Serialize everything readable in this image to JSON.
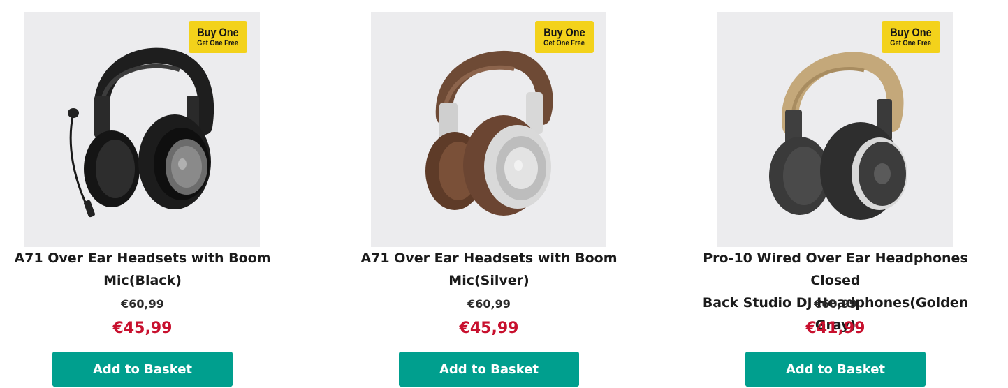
{
  "products": [
    {
      "title_line1": "A71 Over Ear Headsets with Boom",
      "title_line2": "Mic(Black)",
      "old_price": "€60,99",
      "new_price": "€45,99",
      "badge_line1": "Buy One",
      "badge_line2": "Get One Free",
      "button_label": "Add to Basket",
      "image_icon": "headset-black-boom-mic"
    },
    {
      "title_line1": "A71 Over Ear Headsets with Boom",
      "title_line2": "Mic(Silver)",
      "old_price": "€60,99",
      "new_price": "€45,99",
      "badge_line1": "Buy One",
      "badge_line2": "Get One Free",
      "button_label": "Add to Basket",
      "image_icon": "headset-silver-brown"
    },
    {
      "title_line1": "Pro-10 Wired Over Ear Headphones Closed",
      "title_line2": "Back Studio DJ Headphones(Golden Gray)",
      "old_price": "€60,99",
      "new_price": "€41,99",
      "badge_line1": "Buy One",
      "badge_line2": "Get One Free",
      "button_label": "Add to Basket",
      "image_icon": "headphones-golden-gray"
    }
  ],
  "colors": {
    "accent": "#009f8e",
    "sale_price": "#c8102e",
    "badge": "#f3d21b",
    "image_bg": "#ececee"
  }
}
